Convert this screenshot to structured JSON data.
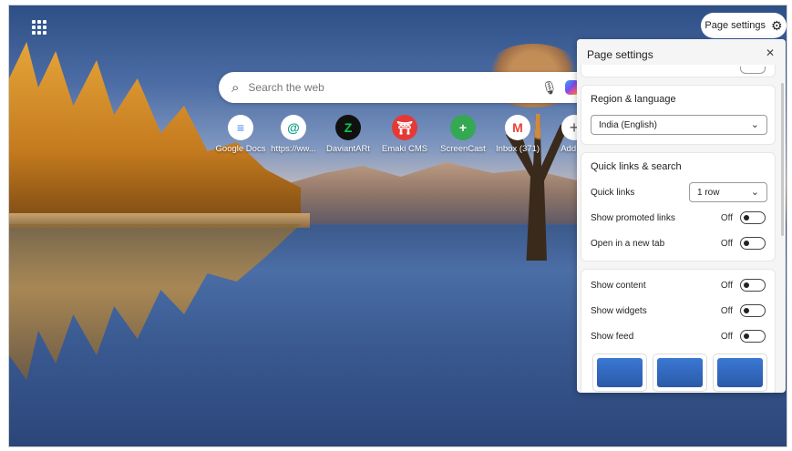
{
  "topbar": {
    "apps_icon": "app-launcher-grid",
    "page_settings_label": "Page settings"
  },
  "search": {
    "placeholder": "Search the web"
  },
  "quick_links": [
    {
      "label": "Google Docs",
      "icon": "docs-icon",
      "color": "#4285f4",
      "glyph": "≡"
    },
    {
      "label": "https://ww...",
      "icon": "web-icon",
      "color": "#0f9d8a",
      "glyph": "@"
    },
    {
      "label": "DaviantARt",
      "icon": "deviantart-icon",
      "color": "#05cc47",
      "glyph": "Z"
    },
    {
      "label": "Emaki CMS",
      "icon": "emaki-icon",
      "color": "#e53935",
      "glyph": "⛩"
    },
    {
      "label": "ScreenCast",
      "icon": "screencast-icon",
      "color": "#34a853",
      "glyph": "+"
    },
    {
      "label": "Inbox (371)",
      "icon": "gmail-icon",
      "color": "#ea4335",
      "glyph": "M"
    },
    {
      "label": "Add sh",
      "icon": "add-icon",
      "color": "#555555",
      "glyph": "+"
    }
  ],
  "panel": {
    "title": "Page settings",
    "region": {
      "title": "Region & language",
      "value": "India (English)"
    },
    "quick_links": {
      "title": "Quick links & search",
      "quick_links_label": "Quick links",
      "quick_links_value": "1 row",
      "promoted_label": "Show promoted links",
      "promoted_state": "Off",
      "new_tab_label": "Open in a new tab",
      "new_tab_state": "Off"
    },
    "content": {
      "show_content_label": "Show content",
      "show_content_state": "Off",
      "widgets_label": "Show widgets",
      "widgets_state": "Off",
      "feed_label": "Show feed",
      "feed_state": "Off"
    }
  }
}
